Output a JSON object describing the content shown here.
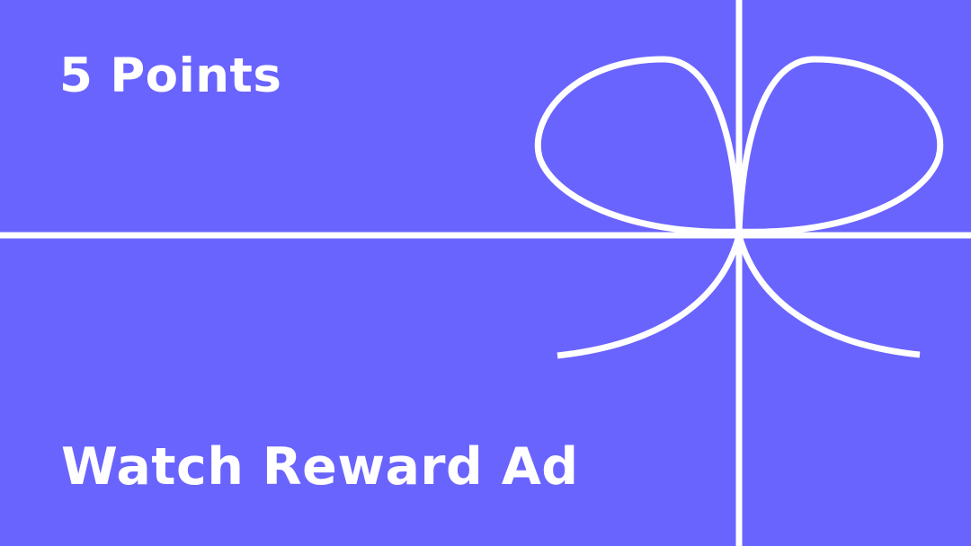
{
  "reward": {
    "points_label": "5 Points",
    "action_label": "Watch Reward Ad",
    "icon": "gift-ribbon-bow-icon"
  },
  "colors": {
    "background": "#6a64fe",
    "foreground": "#ffffff"
  }
}
